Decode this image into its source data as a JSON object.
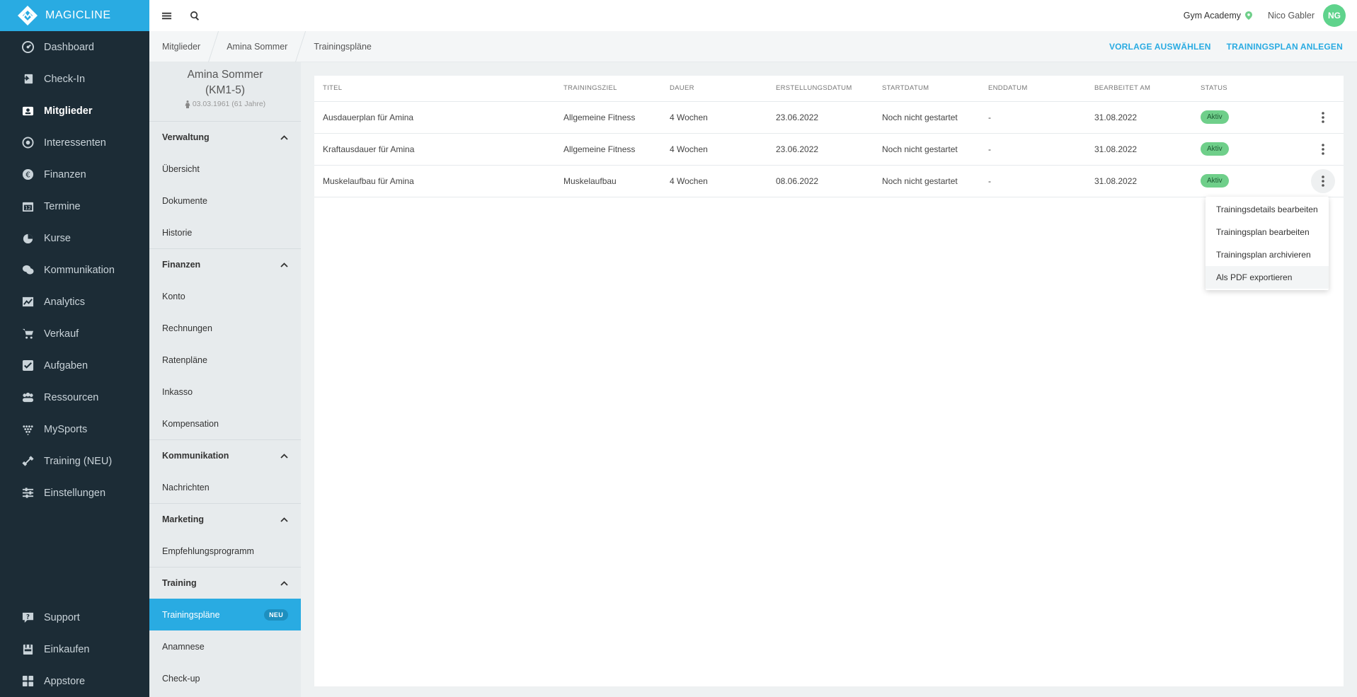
{
  "brand": {
    "name": "MAGICLINE",
    "color": "#29abe2"
  },
  "nav": {
    "items": [
      {
        "label": "Dashboard",
        "icon": "dashboard-icon"
      },
      {
        "label": "Check-In",
        "icon": "check-in-icon"
      },
      {
        "label": "Mitglieder",
        "icon": "members-icon",
        "active": true
      },
      {
        "label": "Interessenten",
        "icon": "prospects-icon"
      },
      {
        "label": "Finanzen",
        "icon": "finance-icon"
      },
      {
        "label": "Termine",
        "icon": "calendar-icon"
      },
      {
        "label": "Kurse",
        "icon": "courses-icon"
      },
      {
        "label": "Kommunikation",
        "icon": "chat-icon"
      },
      {
        "label": "Analytics",
        "icon": "analytics-icon"
      },
      {
        "label": "Verkauf",
        "icon": "cart-icon"
      },
      {
        "label": "Aufgaben",
        "icon": "tasks-icon"
      },
      {
        "label": "Ressourcen",
        "icon": "resources-icon"
      },
      {
        "label": "MySports",
        "icon": "mysports-icon"
      },
      {
        "label": "Training (NEU)",
        "icon": "dumbbell-icon"
      },
      {
        "label": "Einstellungen",
        "icon": "settings-icon"
      }
    ],
    "bottom": [
      {
        "label": "Support",
        "icon": "support-icon"
      },
      {
        "label": "Einkaufen",
        "icon": "shop-icon"
      },
      {
        "label": "Appstore",
        "icon": "appstore-icon"
      }
    ]
  },
  "topbar": {
    "studio": "Gym Academy",
    "user": "Nico Gabler",
    "initials": "NG"
  },
  "breadcrumb": [
    "Mitglieder",
    "Amina Sommer",
    "Trainingspläne"
  ],
  "actions": {
    "template": "VORLAGE AUSWÄHLEN",
    "create": "TRAININGSPLAN ANLEGEN"
  },
  "member": {
    "name": "Amina Sommer",
    "id": "(KM1-5)",
    "dob": "03.03.1961 (61 Jahre)"
  },
  "subnav": {
    "sections": [
      {
        "title": "Verwaltung",
        "items": [
          "Übersicht",
          "Dokumente",
          "Historie"
        ]
      },
      {
        "title": "Finanzen",
        "items": [
          "Konto",
          "Rechnungen",
          "Ratenpläne",
          "Inkasso",
          "Kompensation"
        ]
      },
      {
        "title": "Kommunikation",
        "items": [
          "Nachrichten"
        ]
      },
      {
        "title": "Marketing",
        "items": [
          "Empfehlungsprogramm"
        ]
      },
      {
        "title": "Training",
        "items": [
          "Trainingspläne",
          "Anamnese",
          "Check-up"
        ]
      }
    ],
    "active_item": "Trainingspläne",
    "new_badge": "NEU"
  },
  "table": {
    "headers": [
      "TITEL",
      "TRAININGSZIEL",
      "DAUER",
      "ERSTELLUNGSDATUM",
      "STARTDATUM",
      "ENDDATUM",
      "BEARBEITET AM",
      "STATUS"
    ],
    "rows": [
      {
        "title": "Ausdauerplan für Amina",
        "goal": "Allgemeine Fitness",
        "duration": "4 Wochen",
        "created": "23.06.2022",
        "start": "Noch nicht gestartet",
        "end": "-",
        "edited": "31.08.2022",
        "status": "Aktiv"
      },
      {
        "title": "Kraftausdauer für Amina",
        "goal": "Allgemeine Fitness",
        "duration": "4 Wochen",
        "created": "23.06.2022",
        "start": "Noch nicht gestartet",
        "end": "-",
        "edited": "31.08.2022",
        "status": "Aktiv"
      },
      {
        "title": "Muskelaufbau für Amina",
        "goal": "Muskelaufbau",
        "duration": "4 Wochen",
        "created": "08.06.2022",
        "start": "Noch nicht gestartet",
        "end": "-",
        "edited": "31.08.2022",
        "status": "Aktiv"
      }
    ]
  },
  "dropdown": {
    "items": [
      "Trainingsdetails bearbeiten",
      "Trainingsplan bearbeiten",
      "Trainingsplan archivieren",
      "Als PDF exportieren"
    ]
  }
}
